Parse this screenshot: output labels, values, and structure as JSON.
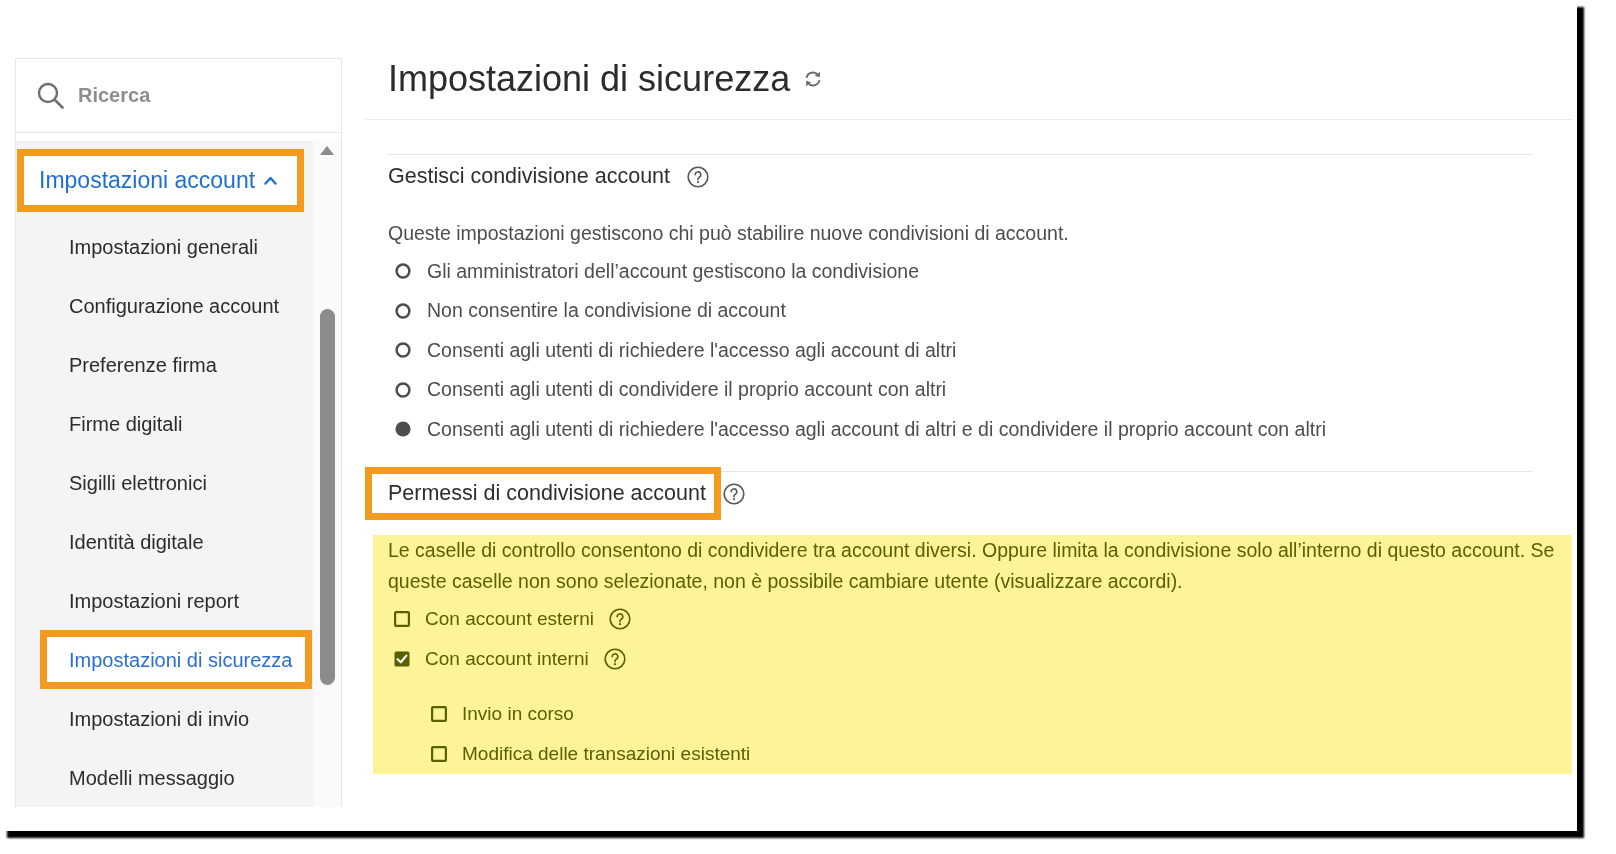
{
  "sidebar": {
    "search": {
      "placeholder": "Ricerca"
    },
    "groups": [
      {
        "label": "Impostazioni account",
        "expanded": true,
        "annotated": true,
        "children": [
          {
            "label": "Impostazioni generali",
            "selected": false,
            "annotated": false
          },
          {
            "label": "Configurazione account",
            "selected": false,
            "annotated": false
          },
          {
            "label": "Preferenze firma",
            "selected": false,
            "annotated": false
          },
          {
            "label": "Firme digitali",
            "selected": false,
            "annotated": false
          },
          {
            "label": "Sigilli elettronici",
            "selected": false,
            "annotated": false
          },
          {
            "label": "Identità digitale",
            "selected": false,
            "annotated": false
          },
          {
            "label": "Impostazioni report",
            "selected": false,
            "annotated": false
          },
          {
            "label": "Impostazioni di sicurezza",
            "selected": true,
            "annotated": true
          },
          {
            "label": "Impostazioni di invio",
            "selected": false,
            "annotated": false
          },
          {
            "label": "Modelli messaggio",
            "selected": false,
            "annotated": false
          }
        ]
      }
    ]
  },
  "page": {
    "title": "Impostazioni di sicurezza"
  },
  "sections": [
    {
      "heading": "Gestisci condivisione account",
      "help": true,
      "annotated": false,
      "highlighted": false,
      "description": "Queste impostazioni gestiscono chi può stabilire nuove condivisioni di account.",
      "options": [
        {
          "kind": "radio",
          "label": "Gli amministratori dell’account gestiscono la condivisione",
          "selected": false
        },
        {
          "kind": "radio",
          "label": "Non consentire la condivisione di account",
          "selected": false
        },
        {
          "kind": "radio",
          "label": "Consenti agli utenti di richiedere l'accesso agli account di altri",
          "selected": false
        },
        {
          "kind": "radio",
          "label": "Consenti agli utenti di condividere il proprio account con altri",
          "selected": false
        },
        {
          "kind": "radio",
          "label": "Consenti agli utenti di richiedere l'accesso agli account di altri e di condividere il proprio account con altri",
          "selected": true
        }
      ]
    },
    {
      "heading": "Permessi di condivisione account",
      "help": true,
      "annotated": true,
      "highlighted": true,
      "description": "Le caselle di controllo consentono di condividere tra account diversi. Oppure limita la condivisione solo all’interno di questo account. Se queste caselle non sono selezionate, non è possibile cambiare utente (visualizzare accordi).",
      "options": [
        {
          "kind": "checkbox",
          "label": "Con account esterni",
          "checked": false,
          "help": true
        },
        {
          "kind": "checkbox",
          "label": "Con account interni",
          "checked": true,
          "help": true,
          "children": [
            {
              "kind": "checkbox",
              "label": "Invio in corso",
              "checked": false,
              "help": false
            },
            {
              "kind": "checkbox",
              "label": "Modifica delle transazioni esistenti",
              "checked": false,
              "help": false
            }
          ]
        }
      ]
    }
  ]
}
